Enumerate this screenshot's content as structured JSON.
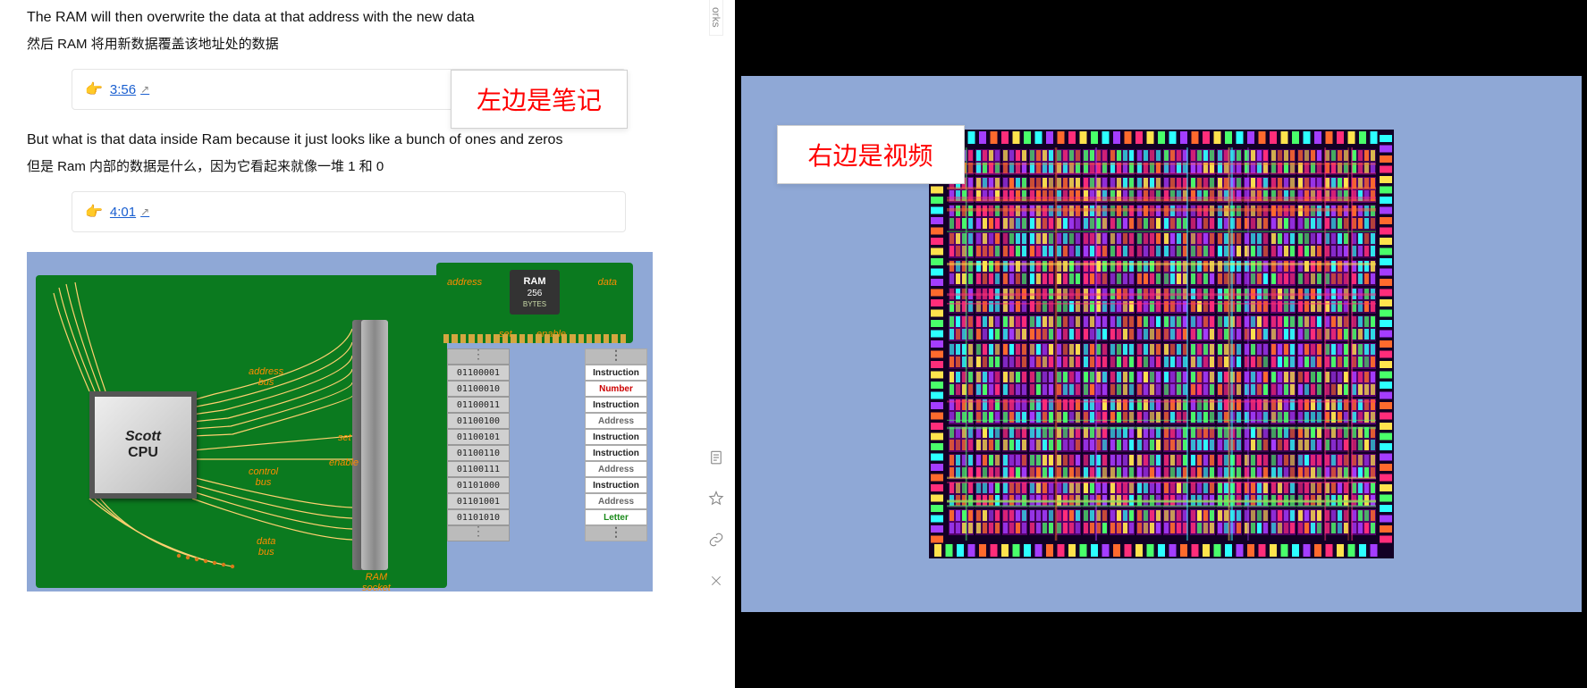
{
  "notes": {
    "line1_en": "The RAM will then overwrite the data at that address with the new data",
    "line1_cn": "然后 RAM 将用新数据覆盖该地址处的数据",
    "ts1_emoji": "👉",
    "ts1": "3:56",
    "line2_en": "But what is that data inside Ram because it just looks like a bunch of ones and zeros",
    "line2_cn": "但是 Ram 内部的数据是什么，因为它看起来就像一堆 1 和 0",
    "ts2_emoji": "👉",
    "ts2": "4:01"
  },
  "labels": {
    "left_badge": "左边是笔记",
    "right_badge": "右边是视频"
  },
  "sidebar": {
    "tab": "orks",
    "icons": {
      "doc": "▥",
      "star": "☆",
      "link": "🔗",
      "close": "✕"
    }
  },
  "diagram": {
    "cpu_line1": "Scott",
    "cpu_line2": "CPU",
    "address_bus": "address",
    "bus": "bus",
    "set": "set",
    "enable": "enable",
    "control_bus": "control",
    "data_bus": "data",
    "ram_socket": "RAM",
    "socket": "socket",
    "ram_label": "RAM",
    "ram_sub1": "256",
    "ram_sub2": "BYTES",
    "address2": "address",
    "data2": "data",
    "set2": "set",
    "enable2": "enable",
    "mem_addresses": [
      "⋮",
      "01100001",
      "01100010",
      "01100011",
      "01100100",
      "01100101",
      "01100110",
      "01100111",
      "01101000",
      "01101001",
      "01101010",
      "⋮"
    ],
    "mem_data": [
      "⋮",
      "Instruction",
      "Number",
      "Instruction",
      "Address",
      "Instruction",
      "Instruction",
      "Address",
      "Instruction",
      "Address",
      "Letter",
      "⋮"
    ],
    "mem_data_class": [
      "dots",
      "",
      "c-number",
      "",
      "c-address",
      "",
      "",
      "c-address",
      "",
      "c-address",
      "c-letter",
      "dots"
    ]
  }
}
